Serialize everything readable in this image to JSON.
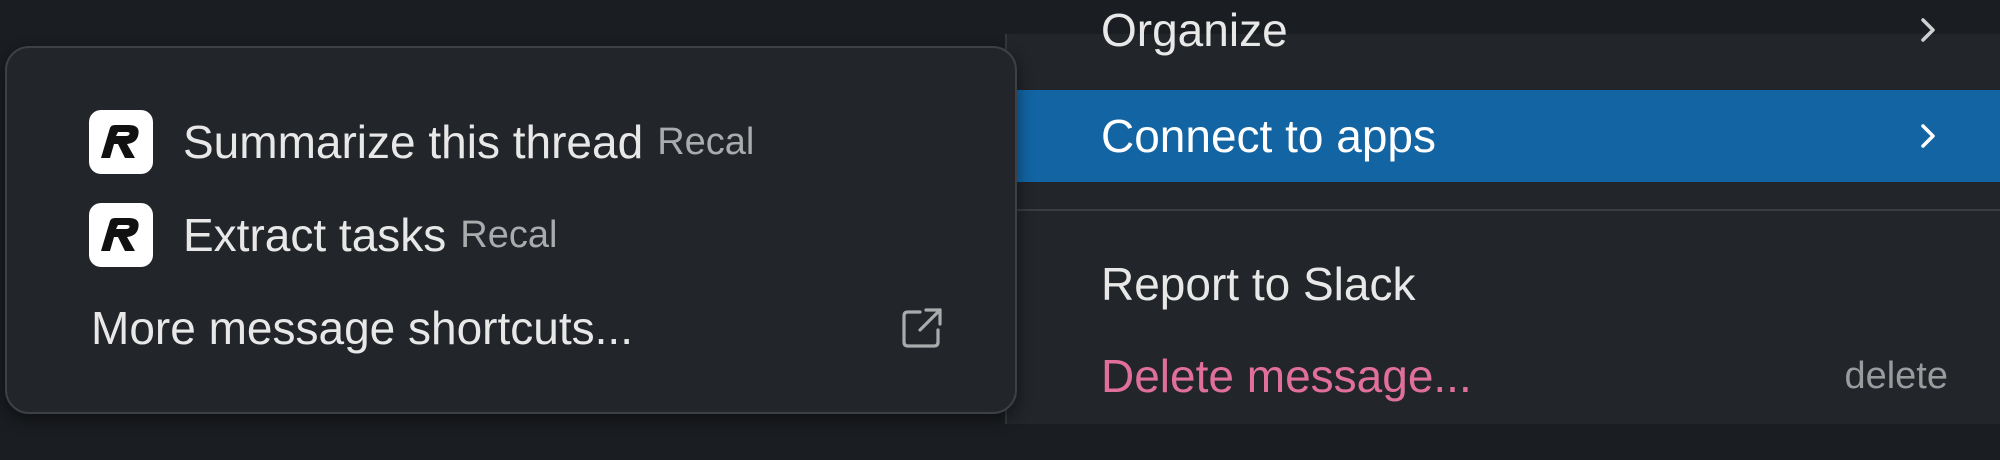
{
  "main_menu": {
    "organize": {
      "label": "Organize"
    },
    "connect": {
      "label": "Connect to apps"
    },
    "report": {
      "label": "Report to Slack"
    },
    "delete": {
      "label": "Delete message...",
      "shortcut": "delete"
    }
  },
  "submenu": {
    "items": [
      {
        "label": "Summarize this thread",
        "app": "Recal",
        "icon": "recal-app-icon"
      },
      {
        "label": "Extract tasks",
        "app": "Recal",
        "icon": "recal-app-icon"
      }
    ],
    "more": {
      "label": "More message shortcuts...",
      "icon": "external-link-icon"
    }
  },
  "colors": {
    "background": "#1a1d21",
    "menu": "#222529",
    "highlight": "#1264a3",
    "danger": "#e0709a",
    "muted": "#a9abad"
  }
}
